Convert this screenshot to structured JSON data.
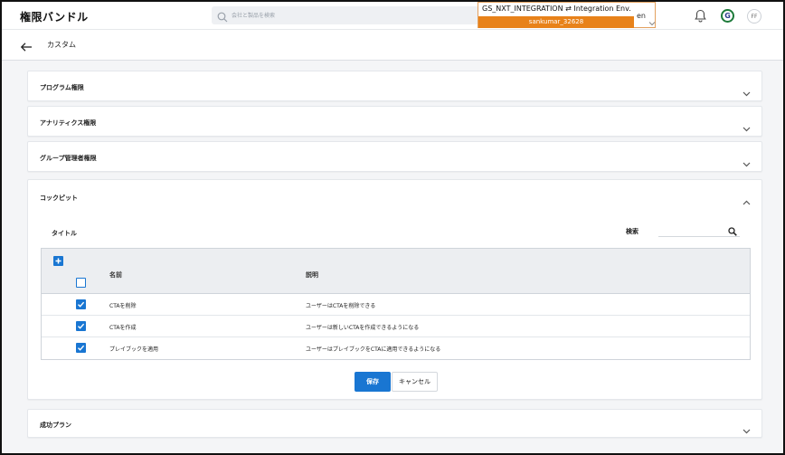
{
  "header": {
    "app_title": "権限バンドル",
    "search_placeholder": "会社と製品を検索",
    "env_name": "GS_NXT_INTEGRATION ⇄ Integration Env.",
    "env_user": "sankumar_32628",
    "language": "en",
    "avatar_initials": "FF",
    "brand_letter": "G"
  },
  "subheader": {
    "title": "カスタム"
  },
  "sections": [
    {
      "title": "プログラム権限",
      "expanded": false
    },
    {
      "title": "アナリティクス権限",
      "expanded": false
    },
    {
      "title": "グループ管理者権限",
      "expanded": false
    },
    {
      "title": "コックピット",
      "expanded": true
    },
    {
      "title": "成功プラン",
      "expanded": false
    }
  ],
  "cockpit": {
    "subtitle": "タイトル",
    "search_label": "検索",
    "table": {
      "columns": [
        "名前",
        "説明"
      ],
      "rows": [
        {
          "name": "CTAを削除",
          "description": "ユーザーはCTAを削除できる",
          "checked": true
        },
        {
          "name": "CTAを作成",
          "description": "ユーザーは新しいCTAを作成できるようになる",
          "checked": true
        },
        {
          "name": "プレイブックを適用",
          "description": "ユーザーはプレイブックをCTAに適用できるようになる",
          "checked": true
        }
      ]
    },
    "save_label": "保存",
    "cancel_label": "キャンセル"
  },
  "colors": {
    "primary": "#1976d2",
    "env_accent": "#e8821a"
  }
}
